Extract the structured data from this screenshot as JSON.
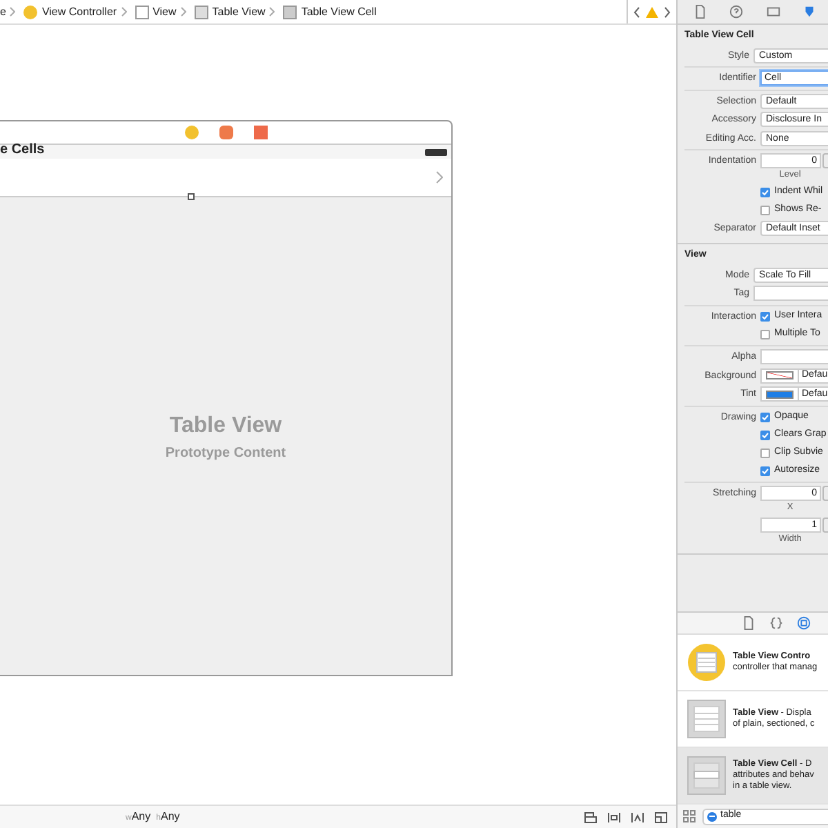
{
  "breadcrumb": {
    "items": [
      {
        "kind": "text",
        "label": "e"
      },
      {
        "kind": "controller",
        "label": "View Controller"
      },
      {
        "kind": "view",
        "label": "View"
      },
      {
        "kind": "table",
        "label": "Table View"
      },
      {
        "kind": "cell",
        "label": "Table View Cell"
      }
    ]
  },
  "scene": {
    "nav_title": "e Cells",
    "placeholder_title": "Table View",
    "placeholder_subtitle": "Prototype Content"
  },
  "inspector": {
    "tabs": [
      {
        "kind": "file",
        "selected": false
      },
      {
        "kind": "help",
        "selected": false
      },
      {
        "kind": "identity",
        "selected": false
      },
      {
        "kind": "attributes",
        "selected": true
      }
    ],
    "sections": [
      {
        "title": "Table View Cell",
        "groups": [
          [
            {
              "kind": "select",
              "label": "Style",
              "value": "Custom"
            }
          ],
          [
            {
              "kind": "field",
              "label": "Identifier",
              "value": "Cell",
              "focused": true
            }
          ],
          [
            {
              "kind": "select",
              "label": "Selection",
              "value": "Default"
            },
            {
              "kind": "select",
              "label": "Accessory",
              "value": "Disclosure In"
            },
            {
              "kind": "select",
              "label": "Editing Acc.",
              "value": "None"
            }
          ],
          [
            {
              "kind": "stepper",
              "label": "Indentation",
              "value": "0",
              "caption": "Level"
            },
            {
              "kind": "check",
              "value": "Indent Whil",
              "checked": true
            },
            {
              "kind": "check",
              "value": "Shows Re-",
              "checked": false
            },
            {
              "kind": "select",
              "label": "Separator",
              "value": "Default Inset"
            }
          ]
        ]
      },
      {
        "title": "View",
        "groups": [
          [
            {
              "kind": "select",
              "label": "Mode",
              "value": "Scale To Fill"
            },
            {
              "kind": "field",
              "label": "Tag",
              "focused": false
            }
          ],
          [
            {
              "kind": "check",
              "label": "Interaction",
              "value": "User Intera",
              "checked": true
            },
            {
              "kind": "check",
              "value": "Multiple To",
              "checked": false
            }
          ],
          [
            {
              "kind": "field",
              "label": "Alpha",
              "focused": false
            },
            {
              "kind": "color",
              "label": "Background",
              "value": "Defau",
              "clear": true
            },
            {
              "kind": "color",
              "label": "Tint",
              "value": "Defau",
              "clear": false,
              "color": "#1e7ee6"
            }
          ],
          [
            {
              "kind": "check",
              "label": "Drawing",
              "value": "Opaque",
              "checked": true
            },
            {
              "kind": "check",
              "value": "Clears Grap",
              "checked": true
            },
            {
              "kind": "check",
              "value": "Clip Subvie",
              "checked": false
            },
            {
              "kind": "check",
              "value": "Autoresize",
              "checked": true
            }
          ],
          [
            {
              "kind": "stepper",
              "label": "Stretching",
              "value": "0",
              "caption": "X"
            },
            {
              "kind": "stepper",
              "value": "1",
              "caption": "Width"
            }
          ]
        ]
      }
    ]
  },
  "library": {
    "tabs": [
      {
        "kind": "file",
        "selected": false
      },
      {
        "kind": "code",
        "selected": false
      },
      {
        "kind": "object",
        "selected": true
      }
    ],
    "items": [
      {
        "kind": "controller",
        "lines": [
          "**Table View Contro**",
          "controller that manag"
        ],
        "selected": false
      },
      {
        "kind": "table",
        "lines": [
          "**Table View** - Displa",
          "of plain, sectioned, c"
        ],
        "selected": false
      },
      {
        "kind": "cell",
        "lines": [
          "**Table View Cell** - D",
          "attributes and behav",
          "in a table view."
        ],
        "selected": true
      }
    ],
    "search": "table"
  },
  "size_class": [
    {
      "prefix": "w",
      "value": "Any"
    },
    {
      "prefix": "h",
      "value": "Any"
    }
  ]
}
